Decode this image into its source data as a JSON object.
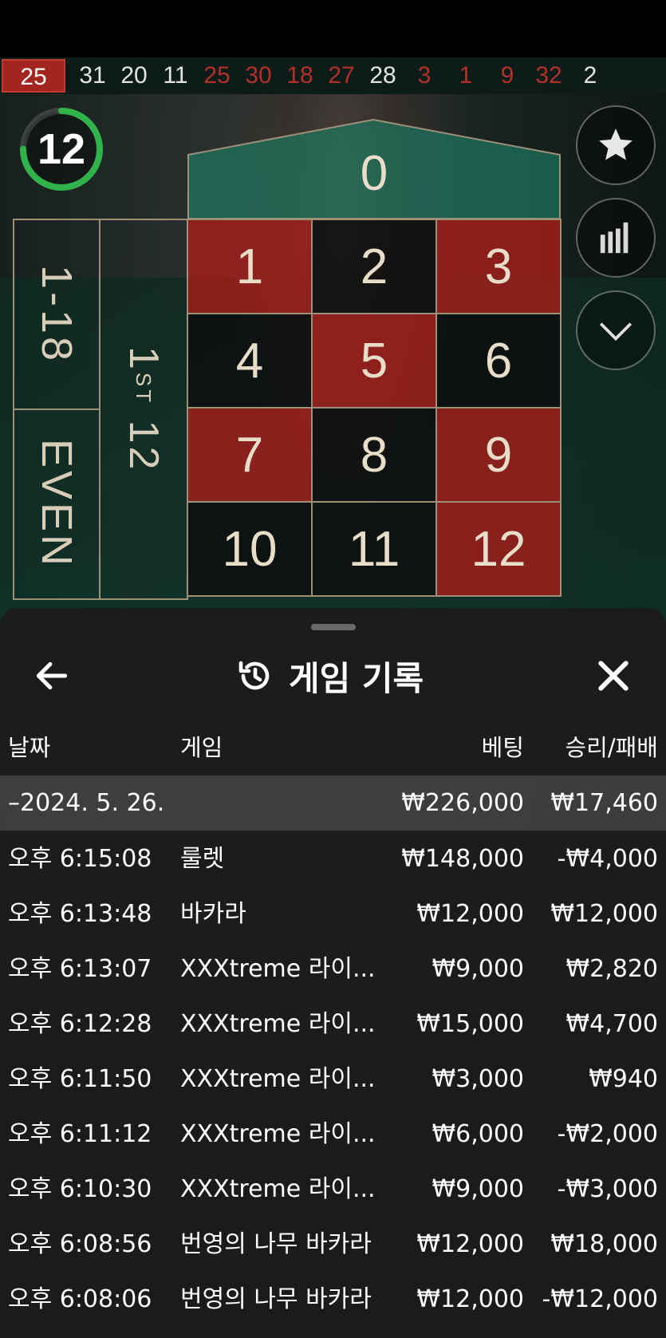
{
  "history_strip": [
    {
      "n": "25",
      "color": "red",
      "current": true
    },
    {
      "n": "31",
      "color": "black"
    },
    {
      "n": "20",
      "color": "black"
    },
    {
      "n": "11",
      "color": "black"
    },
    {
      "n": "25",
      "color": "red"
    },
    {
      "n": "30",
      "color": "red"
    },
    {
      "n": "18",
      "color": "red"
    },
    {
      "n": "27",
      "color": "red"
    },
    {
      "n": "28",
      "color": "black"
    },
    {
      "n": "3",
      "color": "red"
    },
    {
      "n": "1",
      "color": "red"
    },
    {
      "n": "9",
      "color": "red"
    },
    {
      "n": "32",
      "color": "red"
    },
    {
      "n": "2",
      "color": "black"
    }
  ],
  "timer": {
    "value": "12",
    "fraction_remaining": 0.75,
    "color": "#2fb34a"
  },
  "board": {
    "zero": "0",
    "numbers": [
      {
        "n": "1",
        "color": "red"
      },
      {
        "n": "2",
        "color": "black"
      },
      {
        "n": "3",
        "color": "red"
      },
      {
        "n": "4",
        "color": "black"
      },
      {
        "n": "5",
        "color": "red"
      },
      {
        "n": "6",
        "color": "black"
      },
      {
        "n": "7",
        "color": "red"
      },
      {
        "n": "8",
        "color": "black"
      },
      {
        "n": "9",
        "color": "red"
      },
      {
        "n": "10",
        "color": "black"
      },
      {
        "n": "11",
        "color": "black"
      },
      {
        "n": "12",
        "color": "red"
      }
    ],
    "low_label": "1-18",
    "even_label": "EVEN",
    "dozen_label_main": "1",
    "dozen_label_sup": "ST",
    "dozen_label_num": "12"
  },
  "side_buttons": [
    {
      "name": "favorites-button",
      "icon": "star-icon"
    },
    {
      "name": "statistics-button",
      "icon": "bar-chart-icon"
    },
    {
      "name": "collapse-button",
      "icon": "chevron-down-icon"
    }
  ],
  "sheet": {
    "title": "게임 기록",
    "back_icon": "arrow-left-icon",
    "history_icon": "history-icon",
    "close_icon": "close-icon",
    "columns": {
      "date": "날짜",
      "game": "게임",
      "bet": "베팅",
      "result": "승리/패배"
    },
    "date_row": {
      "date": "–2024. 5. 26.",
      "bet": "₩226,000",
      "result": "₩17,460"
    },
    "rows": [
      {
        "time": "오후 6:15:08",
        "game": "룰렛",
        "bet": "₩148,000",
        "result": "-₩4,000"
      },
      {
        "time": "오후 6:13:48",
        "game": "바카라",
        "bet": "₩12,000",
        "result": "₩12,000"
      },
      {
        "time": "오후 6:13:07",
        "game": "XXXtreme 라이...",
        "bet": "₩9,000",
        "result": "₩2,820"
      },
      {
        "time": "오후 6:12:28",
        "game": "XXXtreme 라이...",
        "bet": "₩15,000",
        "result": "₩4,700"
      },
      {
        "time": "오후 6:11:50",
        "game": "XXXtreme 라이...",
        "bet": "₩3,000",
        "result": "₩940"
      },
      {
        "time": "오후 6:11:12",
        "game": "XXXtreme 라이...",
        "bet": "₩6,000",
        "result": "-₩2,000"
      },
      {
        "time": "오후 6:10:30",
        "game": "XXXtreme 라이...",
        "bet": "₩9,000",
        "result": "-₩3,000"
      },
      {
        "time": "오후 6:08:56",
        "game": "번영의 나무 바카라",
        "bet": "₩12,000",
        "result": "₩18,000"
      },
      {
        "time": "오후 6:08:06",
        "game": "번영의 나무 바카라",
        "bet": "₩12,000",
        "result": "-₩12,000"
      }
    ]
  },
  "colors": {
    "red": "#a42520",
    "accent_green": "#2fb34a",
    "sheet_bg": "#1c1c1c"
  }
}
